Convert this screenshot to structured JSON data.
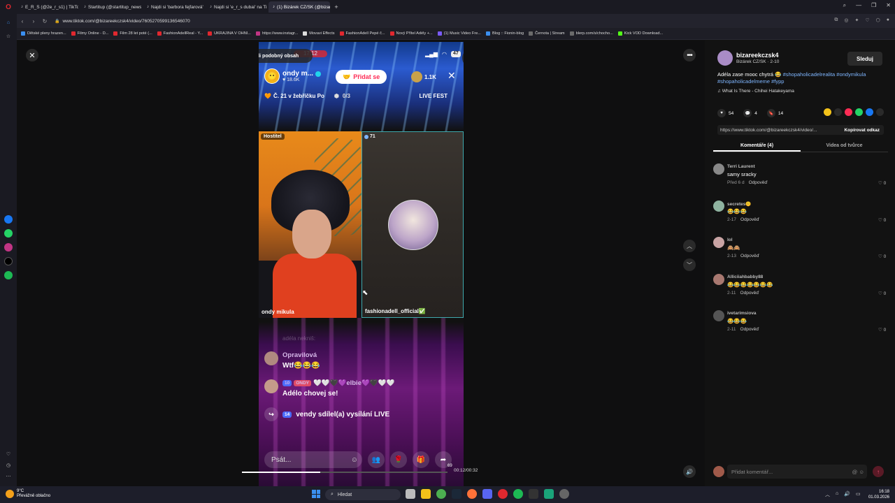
{
  "browser": {
    "tabs": [
      {
        "label": "E_R_S (@2e_r_s1) | TikTok",
        "active": false
      },
      {
        "label": "Startitup (@startitup_news)",
        "active": false
      },
      {
        "label": "Najdi si 'barbora fejfarová'",
        "active": false
      },
      {
        "label": "Najdi si 'e_r_s dubai' na TikToku",
        "active": false
      },
      {
        "label": "(1) Bizárek CZ/SK (@bizareekczsk4)",
        "active": true
      }
    ],
    "url": "www.tiktok.com/@bizareekczsk4/video/7605270599136546070",
    "bookmarks": [
      {
        "label": "Dětské pleny hrazen...",
        "color": "#3b8ff0"
      },
      {
        "label": "Filmy Online - D...",
        "color": "#e0282f"
      },
      {
        "label": "Film 28 let poté (...",
        "color": "#e0282f"
      },
      {
        "label": "FashionAdellReal - Y...",
        "color": "#e0282f"
      },
      {
        "label": "UKRAJINA V OHNI...",
        "color": "#e0282f"
      },
      {
        "label": "https://www.instagr...",
        "color": "#c13584"
      },
      {
        "label": "Movavi Effects",
        "color": "#dddddd"
      },
      {
        "label": "FashionAdell Pepé č...",
        "color": "#e0282f"
      },
      {
        "label": "Nový Přítel Adély +...",
        "color": "#e0282f"
      },
      {
        "label": "(1) Music Video Fre...",
        "color": "#7a5af8"
      },
      {
        "label": "Blog :: Fionin-blog",
        "color": "#3b8ff0"
      },
      {
        "label": "Černota | Stream",
        "color": "#6b6b6b"
      },
      {
        "label": "blerp.com/s/chocho...",
        "color": "#6b6b6b"
      },
      {
        "label": "Kick VOD Download...",
        "color": "#53fc18"
      }
    ]
  },
  "live": {
    "find_similar": "Najdi podobný obsah",
    "phone_time": "17:12",
    "battery": "47",
    "host_name": "ondy m...",
    "host_likes": "18.6K",
    "join_label": "Přidat se",
    "viewers": "1.1K",
    "rank": "Č. 21 v žebříčku Po",
    "progress": "0/3",
    "fest": "LIVE FEST",
    "host_tag": "Hostitel",
    "host_cam_name": "ondy mikula",
    "guest_count": "71",
    "guest_name": "fashionadell_official",
    "guest_emoji": "✅",
    "faded_msg": "adéla nekniš:",
    "messages": [
      {
        "name": "Opravilová",
        "text": "Wtf😂😂😂",
        "badges": []
      },
      {
        "name": "🤍🤍🖤💜elbie💜🖤🤍🤍",
        "text": "Adélo chovej se!",
        "badges": [
          "10",
          "ONDY"
        ]
      }
    ],
    "share": {
      "badge": "14",
      "text": "vendy sdílel(a) vysílání LIVE"
    },
    "comment_placeholder": "Psát...",
    "share_count": "69",
    "progress_fraction": 0.38,
    "time": "00:12/00:32"
  },
  "panel": {
    "author_name": "bizareekczsk4",
    "author_sub": "Bizárek CZ/SK · 2-10",
    "follow": "Sleduj",
    "desc_text": "Adéla zase mooc chytrá 😂",
    "desc_tags": "#shopaholicadelrealita #ondymikula #shopaholicadelmeme #fypp",
    "music": "What Is There - Chihei Hatakeyama",
    "likes": "54",
    "comments": "4",
    "saves": "14",
    "link": "https://www.tiktok.com/@bizareekczsk4/video/...",
    "copy": "Kopírovat odkaz",
    "tab_comments": "Komentáře (4)",
    "tab_videos": "Videa od tvůrce",
    "comments_list": [
      {
        "name": "Terri Laurent",
        "text": "samy sracky",
        "date": "Před 6 d",
        "likes": "0",
        "color": "#888888"
      },
      {
        "name": "secretes🤫",
        "text": "😂😂😂",
        "date": "2-17",
        "likes": "0",
        "color": "#8fb3a0"
      },
      {
        "name": "lol",
        "text": "🙈🙈",
        "date": "2-13",
        "likes": "0",
        "color": "#c9a4a4"
      },
      {
        "name": "Alliciiahbabby88",
        "text": "😂😂😂😂😂😂😂",
        "date": "2-11",
        "likes": "0",
        "color": "#a87870"
      },
      {
        "name": "ivetarimsiova",
        "text": "😂😂😂",
        "date": "2-11",
        "likes": "0",
        "color": "#555555"
      }
    ],
    "reply": "Odpověď",
    "add_comment": "Přidat komentář..."
  },
  "taskbar": {
    "temp": "9°C",
    "weather": "Převážně oblačno",
    "search": "Hledat",
    "time": "16:18",
    "date": "01.03.2026"
  }
}
